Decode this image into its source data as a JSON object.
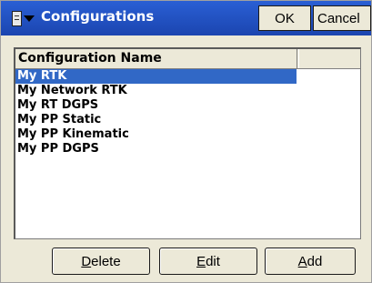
{
  "window": {
    "title": "Configurations",
    "ok_label": "OK",
    "cancel_label": "Cancel"
  },
  "list": {
    "column_header": "Configuration Name",
    "items": [
      {
        "label": "My RTK",
        "selected": true
      },
      {
        "label": "My Network RTK",
        "selected": false
      },
      {
        "label": "My RT DGPS",
        "selected": false
      },
      {
        "label": "My PP Static",
        "selected": false
      },
      {
        "label": "My PP Kinematic",
        "selected": false
      },
      {
        "label": "My PP DGPS",
        "selected": false
      }
    ]
  },
  "buttons": {
    "delete": {
      "mnemonic": "D",
      "rest": "elete"
    },
    "edit": {
      "mnemonic": "E",
      "rest": "dit"
    },
    "add": {
      "mnemonic": "A",
      "rest": "dd"
    }
  },
  "colors": {
    "titlebar": "#1b45b0",
    "selection": "#3168c6",
    "dialog_bg": "#ece9d8"
  },
  "icons": {
    "start_menu": "app-menu-icon",
    "dropdown": "chevron-down-icon"
  }
}
